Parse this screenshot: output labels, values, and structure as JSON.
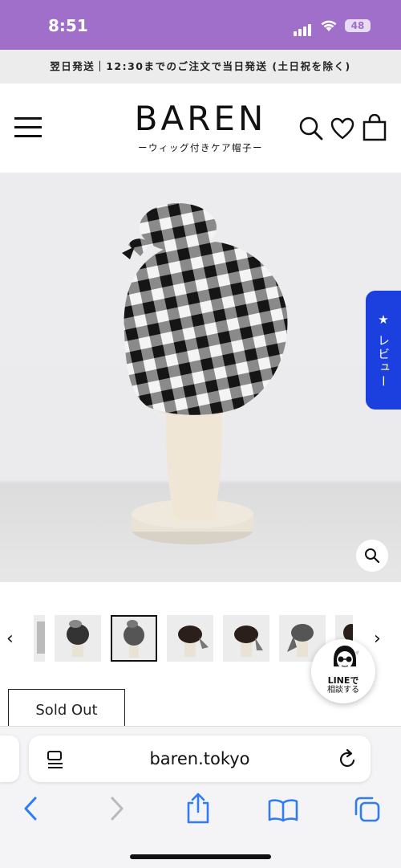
{
  "status_bar": {
    "time": "8:51",
    "battery": "48",
    "background": "#a06fc9"
  },
  "notice": {
    "text": "翌日発送｜12:30までのご注文で当日発送 (土日祝を除く)"
  },
  "header": {
    "logo_name": "BAREN",
    "logo_sub": "ーウィッグ付きケア帽子ー",
    "icons": [
      "menu-icon",
      "search-icon",
      "heart-icon",
      "bag-icon"
    ]
  },
  "review_tab": {
    "label": "★ レビュー",
    "color": "#1c3fe0"
  },
  "gallery": {
    "thumbnail_count": 7,
    "selected_index": 2
  },
  "line_chat": {
    "label": "LINEで",
    "sublabel": "相談する"
  },
  "product": {
    "button_label": "Sold Out"
  },
  "browser": {
    "url": "baren.tokyo",
    "toolbar_icons": [
      "back-icon",
      "forward-icon",
      "share-icon",
      "bookmarks-icon",
      "tabs-icon"
    ]
  }
}
